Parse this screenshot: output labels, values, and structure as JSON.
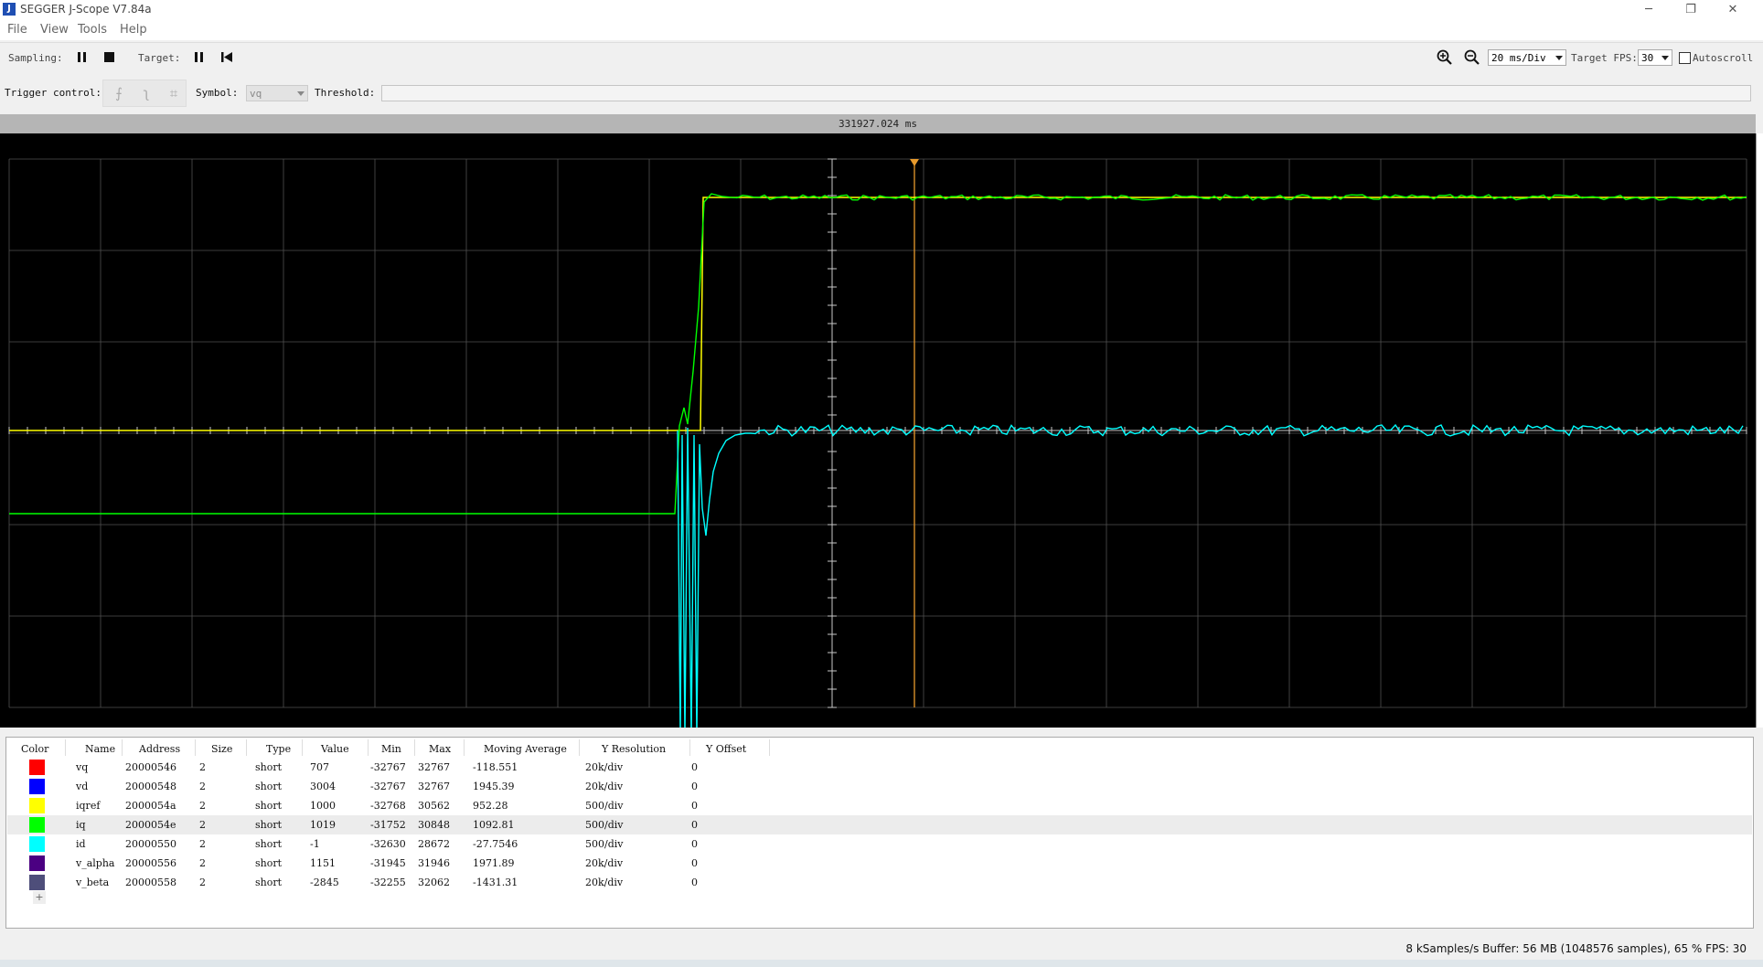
{
  "window": {
    "title": "SEGGER J-Scope V7.84a",
    "icon": "segger-app-icon",
    "controls": {
      "minimize": "─",
      "restore": "❐",
      "close": "✕"
    }
  },
  "menu": [
    "File",
    "View",
    "Tools",
    "Help"
  ],
  "toolbar": {
    "sampling_label": "Sampling:",
    "target_label": "Target:",
    "time_per_div": "20 ms/Div",
    "target_fps_label": "Target FPS:",
    "target_fps": "30",
    "autoscroll_label": "Autoscroll",
    "autoscroll_checked": false,
    "zoom_in_icon": "zoom-in-icon",
    "zoom_out_icon": "zoom-out-icon"
  },
  "trigger": {
    "label": "Trigger control:",
    "buttons": [
      "⨍",
      "ʅ",
      "⌗"
    ],
    "symbol_label": "Symbol:",
    "symbol_value": "vq",
    "threshold_label": "Threshold:",
    "threshold_value": ""
  },
  "scope": {
    "timestamp": "331927.024 ms",
    "background": "#000000",
    "grid_color": "#505050",
    "visible_traces": [
      "iqref",
      "iq",
      "id"
    ]
  },
  "table": {
    "headers": [
      "Color",
      "Name",
      "Address",
      "Size",
      "Type",
      "Value",
      "Min",
      "Max",
      "Moving Average",
      "Y Resolution",
      "Y Offset"
    ],
    "selected_row": 3,
    "rows": [
      {
        "color": "#ff0000",
        "name": "vq",
        "address": "20000546",
        "size": "2",
        "type": "short",
        "value": "707",
        "min": "-32767",
        "max": "32767",
        "avg": "-118.551",
        "yres": "20k/div",
        "yoff": "0"
      },
      {
        "color": "#0000ff",
        "name": "vd",
        "address": "20000548",
        "size": "2",
        "type": "short",
        "value": "3004",
        "min": "-32767",
        "max": "32767",
        "avg": "1945.39",
        "yres": "20k/div",
        "yoff": "0"
      },
      {
        "color": "#ffff00",
        "name": "iqref",
        "address": "2000054a",
        "size": "2",
        "type": "short",
        "value": "1000",
        "min": "-32768",
        "max": "30562",
        "avg": "952.28",
        "yres": "500/div",
        "yoff": "0"
      },
      {
        "color": "#00ff00",
        "name": "iq",
        "address": "2000054e",
        "size": "2",
        "type": "short",
        "value": "1019",
        "min": "-31752",
        "max": "30848",
        "avg": "1092.81",
        "yres": "500/div",
        "yoff": "0"
      },
      {
        "color": "#00ffff",
        "name": "id",
        "address": "20000550",
        "size": "2",
        "type": "short",
        "value": "-1",
        "min": "-32630",
        "max": "28672",
        "avg": "-27.7546",
        "yres": "500/div",
        "yoff": "0"
      },
      {
        "color": "#4b0082",
        "name": "v_alpha",
        "address": "20000556",
        "size": "2",
        "type": "short",
        "value": "1151",
        "min": "-31945",
        "max": "31946",
        "avg": "1971.89",
        "yres": "20k/div",
        "yoff": "0"
      },
      {
        "color": "#4e4e7a",
        "name": "v_beta",
        "address": "20000558",
        "size": "2",
        "type": "short",
        "value": "-2845",
        "min": "-32255",
        "max": "32062",
        "avg": "-1431.31",
        "yres": "20k/div",
        "yoff": "0"
      }
    ],
    "add_label": "+"
  },
  "status": "8 kSamples/s Buffer: 56 MB (1048576 samples), 65 % FPS: 30"
}
